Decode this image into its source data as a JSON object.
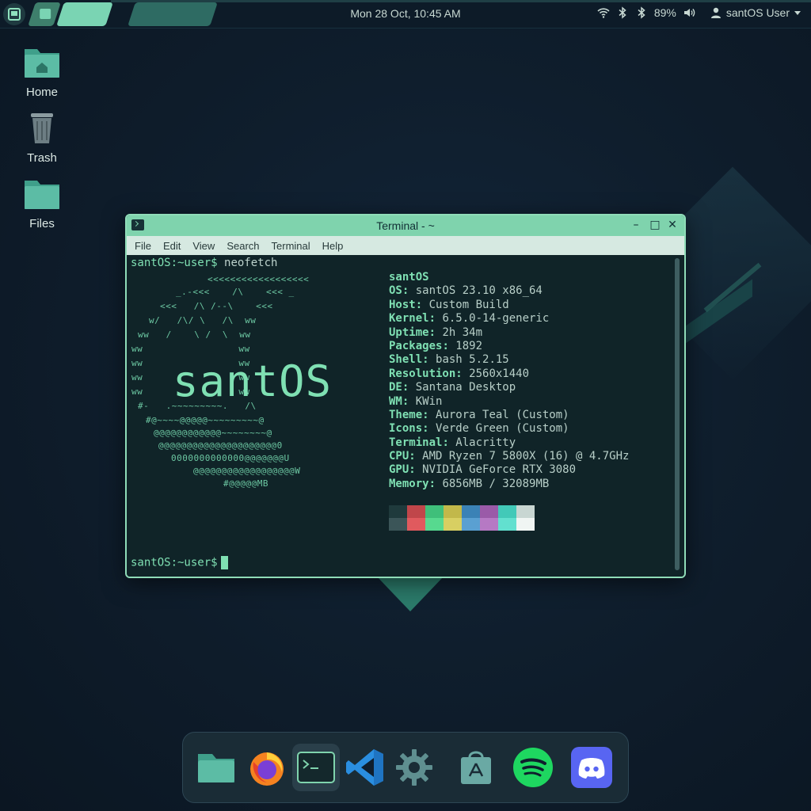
{
  "top_panel": {
    "clock": "Mon 28 Oct, 10:45 AM",
    "battery": "89%",
    "user": "santOS User",
    "icons": [
      "app-launcher-icon",
      "wifi-icon",
      "bluetooth-icon",
      "bluetooth-icon",
      "volume-icon",
      "user-icon",
      "caret-down-icon"
    ]
  },
  "desktop": {
    "icons": [
      {
        "label": "Home",
        "icon": "home-folder-icon"
      },
      {
        "label": "Trash",
        "icon": "trash-icon"
      },
      {
        "label": "Files",
        "icon": "folder-icon"
      }
    ]
  },
  "terminal": {
    "title": "Terminal - ~",
    "menu": [
      "File",
      "Edit",
      "View",
      "Search",
      "Terminal",
      "Help"
    ],
    "prompt": "santOS:~user$",
    "command": "neofetch",
    "art_text": "santOS",
    "art_lines": [
      "<<<<<<<<<<<<<<<<<<",
      "_.-<<<    /\\    <<< _",
      "<<<   /\\ /--\\    <<<",
      "w/   /\\/ \\   /\\  ww",
      "ww   /    \\ /  \\  ww",
      "ww                 ww",
      "ww                 ww",
      "ww                 ww",
      "ww                 ww",
      "#-   .~~~~~~~~~.   /\\",
      "#@~~~~@@@@@~~~~~~~~~@",
      "@@@@@@@@@@@@~~~~~~~~@",
      "@@@@@@@@@@@@@@@@@@@@@0",
      "0000000000000@@@@@@@U",
      "@@@@@@@@@@@@@@@@@@W",
      "#@@@@@MB"
    ],
    "info_header": "santOS",
    "info": [
      {
        "key": "OS",
        "value": "santOS 23.10 x86_64"
      },
      {
        "key": "Host",
        "value": "Custom Build"
      },
      {
        "key": "Kernel",
        "value": "6.5.0-14-generic"
      },
      {
        "key": "Uptime",
        "value": "2h 34m"
      },
      {
        "key": "Packages",
        "value": "1892"
      },
      {
        "key": "Shell",
        "value": "bash 5.2.15"
      },
      {
        "key": "Resolution",
        "value": "2560x1440"
      },
      {
        "key": "DE",
        "value": "Santana Desktop"
      },
      {
        "key": "WM",
        "value": "KWin"
      },
      {
        "key": "Theme",
        "value": "Aurora Teal (Custom)"
      },
      {
        "key": "Icons",
        "value": "Verde Green (Custom)"
      },
      {
        "key": "Terminal",
        "value": "Alacritty"
      },
      {
        "key": "CPU",
        "value": "AMD Ryzen 7 5800X (16) @ 4.7GHz"
      },
      {
        "key": "GPU",
        "value": "NVIDIA GeForce RTX 3080"
      },
      {
        "key": "Memory",
        "value": "6856MB / 32089MB"
      }
    ],
    "palette": {
      "row1": [
        "#1f3a3c",
        "#c0464a",
        "#3fbf7a",
        "#c2b84a",
        "#3b82b6",
        "#9a5aa8",
        "#42c9b8",
        "#c8d6d2"
      ],
      "row2": [
        "#3b5558",
        "#e05a5e",
        "#57d98f",
        "#d8cf62",
        "#5aa0d2",
        "#b679c4",
        "#62e0cf",
        "#f0f5f3"
      ]
    }
  },
  "dock": {
    "apps": [
      "files-icon",
      "firefox-icon",
      "terminal-icon",
      "vscode-icon",
      "settings-icon",
      "app-store-icon",
      "spotify-icon",
      "discord-icon"
    ]
  },
  "colors": {
    "accent": "#7fd3ad",
    "background": "#0f1e2d",
    "terminal_bg": "#102428",
    "prompt": "#7fe0b3"
  }
}
